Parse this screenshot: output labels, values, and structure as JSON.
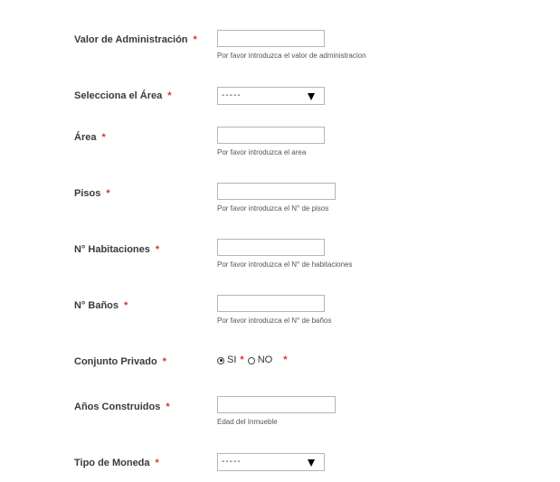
{
  "form": {
    "required_mark": "*",
    "valor_admin": {
      "label": "Valor de Administración",
      "value": "",
      "hint": "Por favor introduzca el valor de administracion"
    },
    "area_select": {
      "label": "Selecciona el Área",
      "selected": "-----"
    },
    "area": {
      "label": "Área",
      "value": "",
      "hint": "Por favor introduzca el area"
    },
    "pisos": {
      "label": "Pisos",
      "value": "",
      "hint": "Por favor introduzca el N° de pisos"
    },
    "habitaciones": {
      "label": "N° Habitaciones",
      "value": "",
      "hint": "Por favor introduzca el N° de habitaciones"
    },
    "banos": {
      "label": "N° Baños",
      "value": "",
      "hint": "Por favor introduzca el N° de baños"
    },
    "conjunto_privado": {
      "label": "Conjunto Privado",
      "options": [
        {
          "label": "SI",
          "checked": true
        },
        {
          "label": "NO",
          "checked": false
        }
      ]
    },
    "anos_construidos": {
      "label": "Años Construidos",
      "value": "",
      "hint": "Edad del Inmueble"
    },
    "tipo_moneda": {
      "label": "Tipo de Moneda",
      "selected": "-----"
    }
  }
}
